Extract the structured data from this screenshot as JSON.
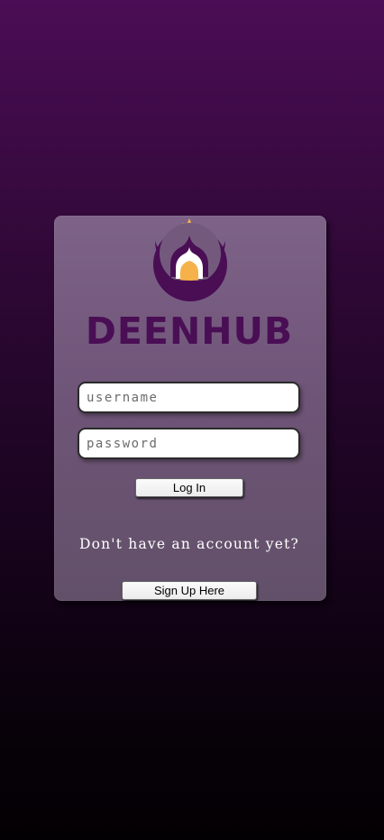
{
  "brand": {
    "name": "DEENHUB",
    "logo_icon": "mosque-crescent-star-icon",
    "colors": {
      "primary": "#4a0e55",
      "accent": "#f5b24a",
      "card": "#735a7d"
    }
  },
  "login": {
    "username_placeholder": "username",
    "password_placeholder": "password",
    "login_label": "Log In"
  },
  "signup": {
    "prompt": "Don't have an account yet?",
    "button_label": "Sign Up Here"
  }
}
